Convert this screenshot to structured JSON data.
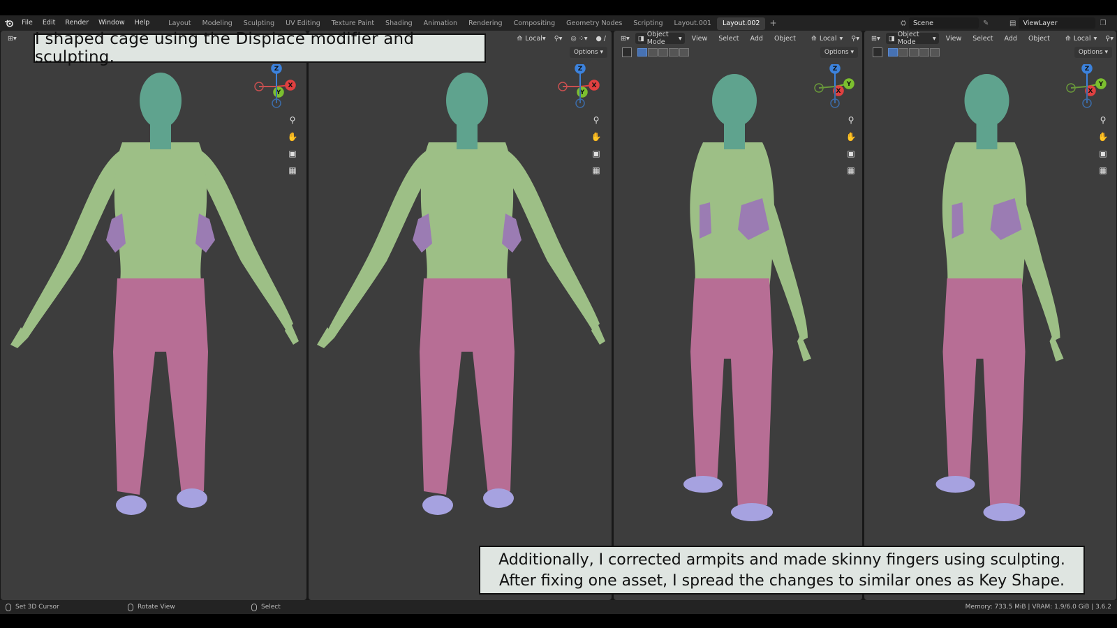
{
  "menu": [
    "File",
    "Edit",
    "Render",
    "Window",
    "Help"
  ],
  "workspaces": [
    "Layout",
    "Modeling",
    "Sculpting",
    "UV Editing",
    "Texture Paint",
    "Shading",
    "Animation",
    "Rendering",
    "Compositing",
    "Geometry Nodes",
    "Scripting",
    "Layout.001",
    "Layout.002"
  ],
  "active_workspace": "Layout.002",
  "scene": "Scene",
  "view_layer": "ViewLayer",
  "viewport_headers": {
    "mode": "Object Mode",
    "menus": [
      "View",
      "Select",
      "Add",
      "Object"
    ],
    "orientation": "Local",
    "options": "Options"
  },
  "captions": {
    "top": "I shaped cage using the Displace modifier and sculpting.",
    "bottom_line1": "Additionally, I corrected armpits and made skinny fingers using sculpting.",
    "bottom_line2": "After fixing one asset, I spread the changes to similar ones as Key Shape."
  },
  "status": {
    "left": "Set 3D Cursor",
    "middle": "Rotate View",
    "right_action": "Select",
    "stats": "Memory: 733.5 MiB | VRAM: 1.9/6.0 GiB | 3.6.2"
  },
  "gizmo_labels": {
    "x": "X",
    "y": "Y",
    "z": "Z"
  },
  "colors": {
    "skin": "#5fa38e",
    "shirt": "#9dbf86",
    "pants": "#b76e95",
    "holster": "#9b7cb3",
    "shoes": "#a6a2e0",
    "viewport_bg": "#3d3d3d"
  }
}
